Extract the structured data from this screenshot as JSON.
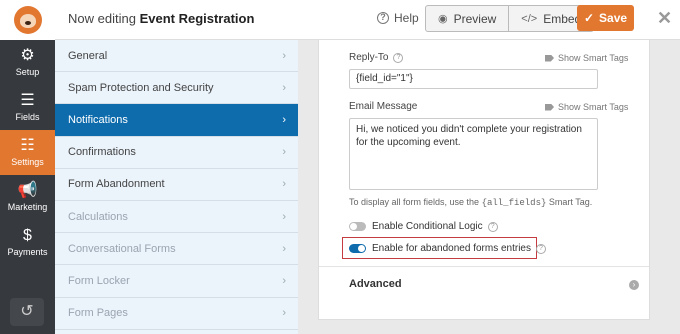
{
  "header": {
    "title_prefix": "Now editing",
    "title_form": "Event Registration",
    "help_label": "Help",
    "preview_label": "Preview",
    "embed_label": "Embed",
    "save_label": "Save",
    "colors": {
      "accent": "#e27730"
    }
  },
  "leftnav": {
    "items": [
      {
        "label": "Setup",
        "icon": "gear-icon"
      },
      {
        "label": "Fields",
        "icon": "list-icon"
      },
      {
        "label": "Settings",
        "icon": "sliders-icon"
      },
      {
        "label": "Marketing",
        "icon": "megaphone-icon"
      },
      {
        "label": "Payments",
        "icon": "dollar-icon"
      }
    ],
    "history_icon": "history-icon",
    "active": "Settings"
  },
  "panel": {
    "items": [
      {
        "label": "General"
      },
      {
        "label": "Spam Protection and Security"
      },
      {
        "label": "Notifications"
      },
      {
        "label": "Confirmations"
      },
      {
        "label": "Form Abandonment"
      },
      {
        "label": "Calculations"
      },
      {
        "label": "Conversational Forms"
      },
      {
        "label": "Form Locker"
      },
      {
        "label": "Form Pages"
      }
    ],
    "active": "Notifications",
    "active_color": "#0e6cad"
  },
  "form": {
    "reply_to_label": "Reply-To",
    "show_smart_tags": "Show Smart Tags",
    "reply_to_value": "{field_id=\"1\"}",
    "email_message_label": "Email Message",
    "email_message_value": "Hi, we noticed you didn't complete your registration for the upcoming event.",
    "hint_prefix": "To display all form fields, use the",
    "hint_code": "{all_fields}",
    "hint_suffix": "Smart Tag.",
    "conditional_logic_label": "Enable Conditional Logic",
    "conditional_logic_on": false,
    "abandoned_label": "Enable for abandoned forms entries",
    "abandoned_on": true,
    "advanced_label": "Advanced"
  }
}
